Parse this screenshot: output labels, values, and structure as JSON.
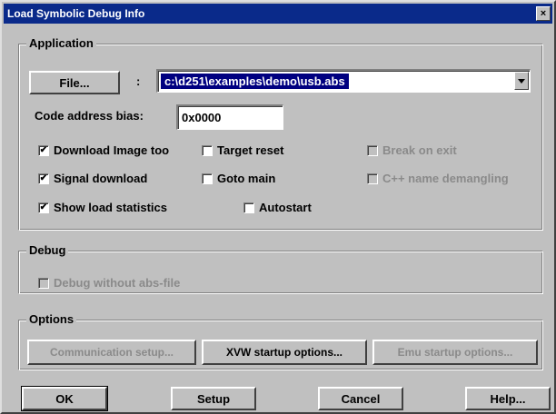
{
  "window": {
    "title": "Load Symbolic Debug Info",
    "close_glyph": "×"
  },
  "application": {
    "legend": "Application",
    "file_button": "File...",
    "separator": ":",
    "file_path": "c:\\d251\\examples\\demo\\usb.abs",
    "code_bias_label": "Code address bias:",
    "code_bias_value": "0x0000",
    "checkboxes": {
      "download_image": {
        "label": "Download Image too",
        "checked": true,
        "enabled": true
      },
      "target_reset": {
        "label": "Target reset",
        "checked": false,
        "enabled": true
      },
      "break_on_exit": {
        "label": "Break on exit",
        "checked": false,
        "enabled": false
      },
      "signal_download": {
        "label": "Signal download",
        "checked": true,
        "enabled": true
      },
      "goto_main": {
        "label": "Goto main",
        "checked": false,
        "enabled": true
      },
      "cpp_demangling": {
        "label": "C++ name demangling",
        "checked": false,
        "enabled": false
      },
      "show_load_stats": {
        "label": "Show load statistics",
        "checked": true,
        "enabled": true
      },
      "autostart": {
        "label": "Autostart",
        "checked": false,
        "enabled": true
      }
    }
  },
  "debug": {
    "legend": "Debug",
    "debug_without_abs": {
      "label": "Debug without abs-file",
      "checked": false,
      "enabled": false
    }
  },
  "options": {
    "legend": "Options",
    "communication_setup": "Communication setup...",
    "xvw_startup": "XVW startup options...",
    "emu_startup": "Emu startup options..."
  },
  "footer": {
    "ok": "OK",
    "setup": "Setup",
    "cancel": "Cancel",
    "help": "Help..."
  },
  "icons": {
    "check": "✔",
    "dropdown": "chevron-down-icon",
    "close": "close-icon"
  },
  "colors": {
    "titlebar": "#0a2a8a",
    "selection": "#000080",
    "face": "#c0c0c0",
    "disabled_text": "#8a8a8a"
  }
}
